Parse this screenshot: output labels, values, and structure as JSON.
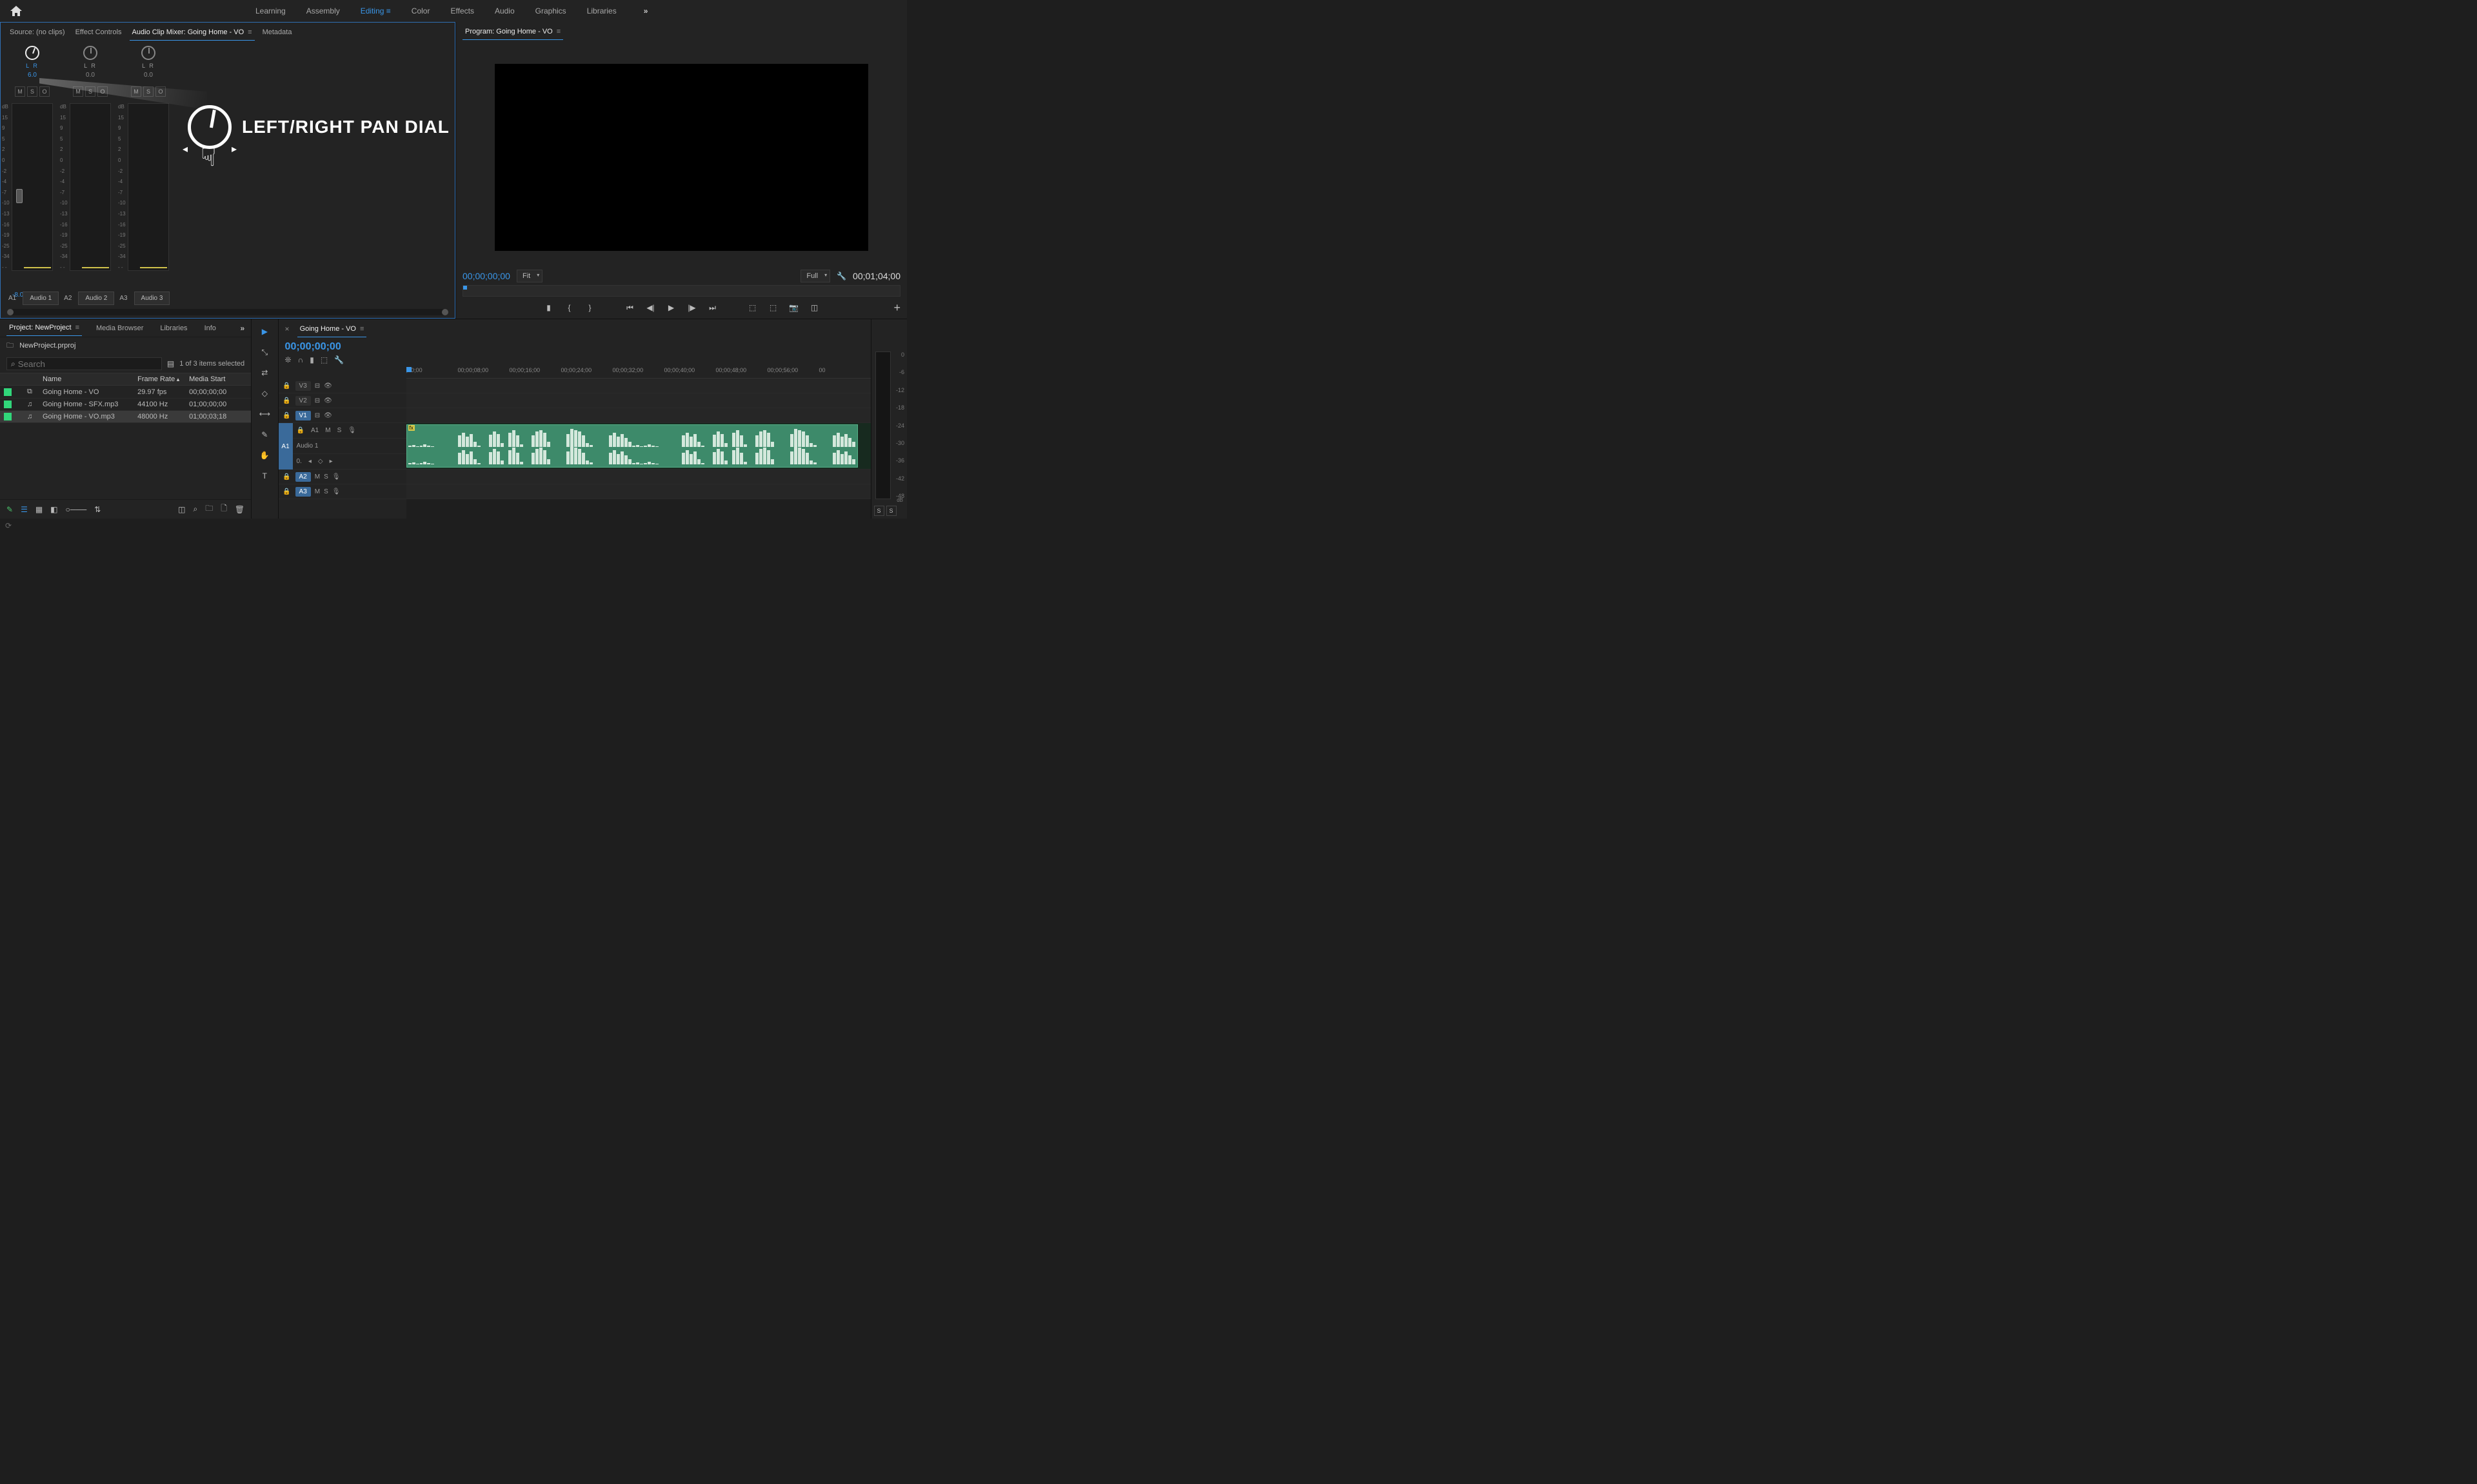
{
  "workspaces": [
    "Learning",
    "Assembly",
    "Editing",
    "Color",
    "Effects",
    "Audio",
    "Graphics",
    "Libraries"
  ],
  "workspace_active": "Editing",
  "mixer": {
    "tabs": {
      "source": "Source: (no clips)",
      "effect": "Effect Controls",
      "acm": "Audio Clip Mixer: Going Home - VO",
      "meta": "Metadata"
    },
    "channels": [
      {
        "lr": "L   R",
        "pan": "6.0",
        "active": true,
        "id": "A1",
        "name": "Audio 1",
        "db": "-8.0"
      },
      {
        "lr": "L   R",
        "pan": "0.0",
        "active": false,
        "id": "A2",
        "name": "Audio 2"
      },
      {
        "lr": "L   R",
        "pan": "0.0",
        "active": false,
        "id": "A3",
        "name": "Audio 3"
      }
    ],
    "mso": [
      "M",
      "S",
      "O"
    ],
    "meter_scale": [
      "dB",
      "15",
      "9",
      "5",
      "2",
      "0",
      "-2",
      "-4",
      "-7",
      "-10",
      "-13",
      "-16",
      "-19",
      "-25",
      "-34",
      "- -"
    ],
    "db_label": "dB"
  },
  "program": {
    "title": "Program: Going Home - VO",
    "tc": "00;00;00;00",
    "fit": "Fit",
    "quality": "Full",
    "duration": "00;01;04;00"
  },
  "project": {
    "tabs": {
      "project": "Project: NewProject",
      "media": "Media Browser",
      "libs": "Libraries",
      "info": "Info"
    },
    "filename": "NewProject.prproj",
    "selection": "1 of 3 items selected",
    "cols": {
      "name": "Name",
      "rate": "Frame Rate",
      "start": "Media Start"
    },
    "rows": [
      {
        "color": "#31d67a",
        "icon": "seq",
        "name": "Going Home - VO",
        "rate": "29.97 fps",
        "start": "00;00;00;00",
        "sel": false
      },
      {
        "color": "#31d67a",
        "icon": "aud",
        "name": "Going Home - SFX.mp3",
        "rate": "44100 Hz",
        "start": "01;00;00;00",
        "sel": false
      },
      {
        "color": "#31d67a",
        "icon": "aud",
        "name": "Going Home - VO.mp3",
        "rate": "48000 Hz",
        "start": "01;00;03;18",
        "sel": true
      }
    ],
    "search_placeholder": "Search"
  },
  "timeline": {
    "title": "Going Home - VO",
    "tc": "00;00;00;00",
    "ruler": [
      ";00;00",
      "00;00;08;00",
      "00;00;16;00",
      "00;00;24;00",
      "00;00;32;00",
      "00;00;40;00",
      "00;00;48;00",
      "00;00;56;00",
      "00"
    ],
    "vtracks": [
      "V3",
      "V2",
      "V1"
    ],
    "atracks": {
      "A1": {
        "label": "A1",
        "name": "Audio 1",
        "m": "M",
        "s": "S"
      },
      "A2": {
        "label": "A2",
        "m": "M",
        "s": "S"
      },
      "A3": {
        "label": "A3",
        "m": "M",
        "s": "S"
      }
    },
    "src_a1": "A1"
  },
  "meter": {
    "scale": [
      "0",
      "-6",
      "-12",
      "-18",
      "-24",
      "-30",
      "-36",
      "-42",
      "-48"
    ],
    "db": "dB",
    "ss": [
      "S",
      "S"
    ]
  },
  "annotation": "LEFT/RIGHT PAN DIAL",
  "glyph": {
    "magnify": "⌕"
  }
}
